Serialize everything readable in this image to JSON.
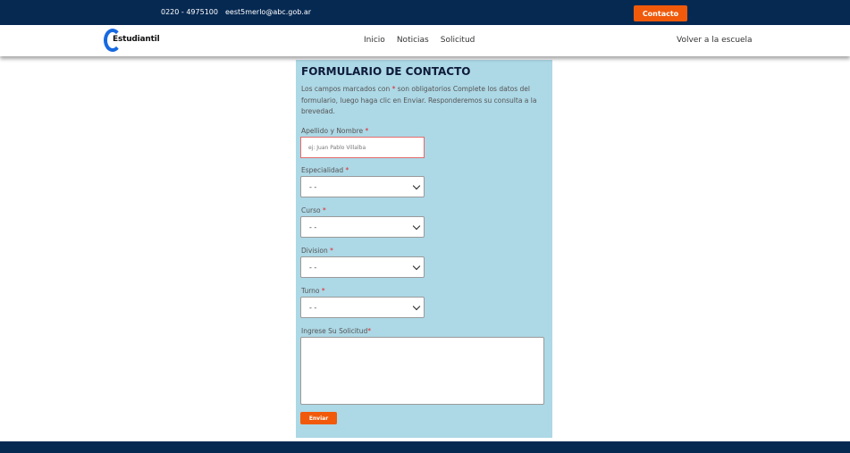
{
  "topbar": {
    "phone": "0220 - 4975100",
    "email": "eest5merlo@abc.gob.ar",
    "contact_button": "Contacto"
  },
  "navbar": {
    "logo_text": "Estudiantil",
    "links": [
      "Inicio",
      "Noticias",
      "Solicitud"
    ],
    "back_link": "Volver a la escuela"
  },
  "form": {
    "title": "FORMULARIO DE CONTACTO",
    "intro_pre": "Los campos marcados con ",
    "required_mark": "*",
    "intro_post": " son obligatorios Complete los datos del formulario, luego haga clic en Enviar. Responderemos su consulta a la brevedad.",
    "name_label": "Apellido y Nombre",
    "name_placeholder": "ej: Juan Pablo Villalba",
    "especialidad_label": "Especialidad",
    "especialidad_value": "- -",
    "curso_label": "Curso",
    "curso_value": "- -",
    "division_label": "Division",
    "division_value": "- -",
    "turno_label": "Turno",
    "turno_value": "- -",
    "solicitud_label": "Ingrese Su Solicitud",
    "solicitud_value": "",
    "submit_label": "Enviar"
  },
  "colors": {
    "navy": "#062952",
    "orange": "#f05a0a",
    "panel": "#add8e6",
    "required": "#e0262b",
    "logo_blue": "#1769e0"
  },
  "icons": {
    "select_arrow": "chevron-down-icon",
    "logo": "c-ring-logo"
  }
}
